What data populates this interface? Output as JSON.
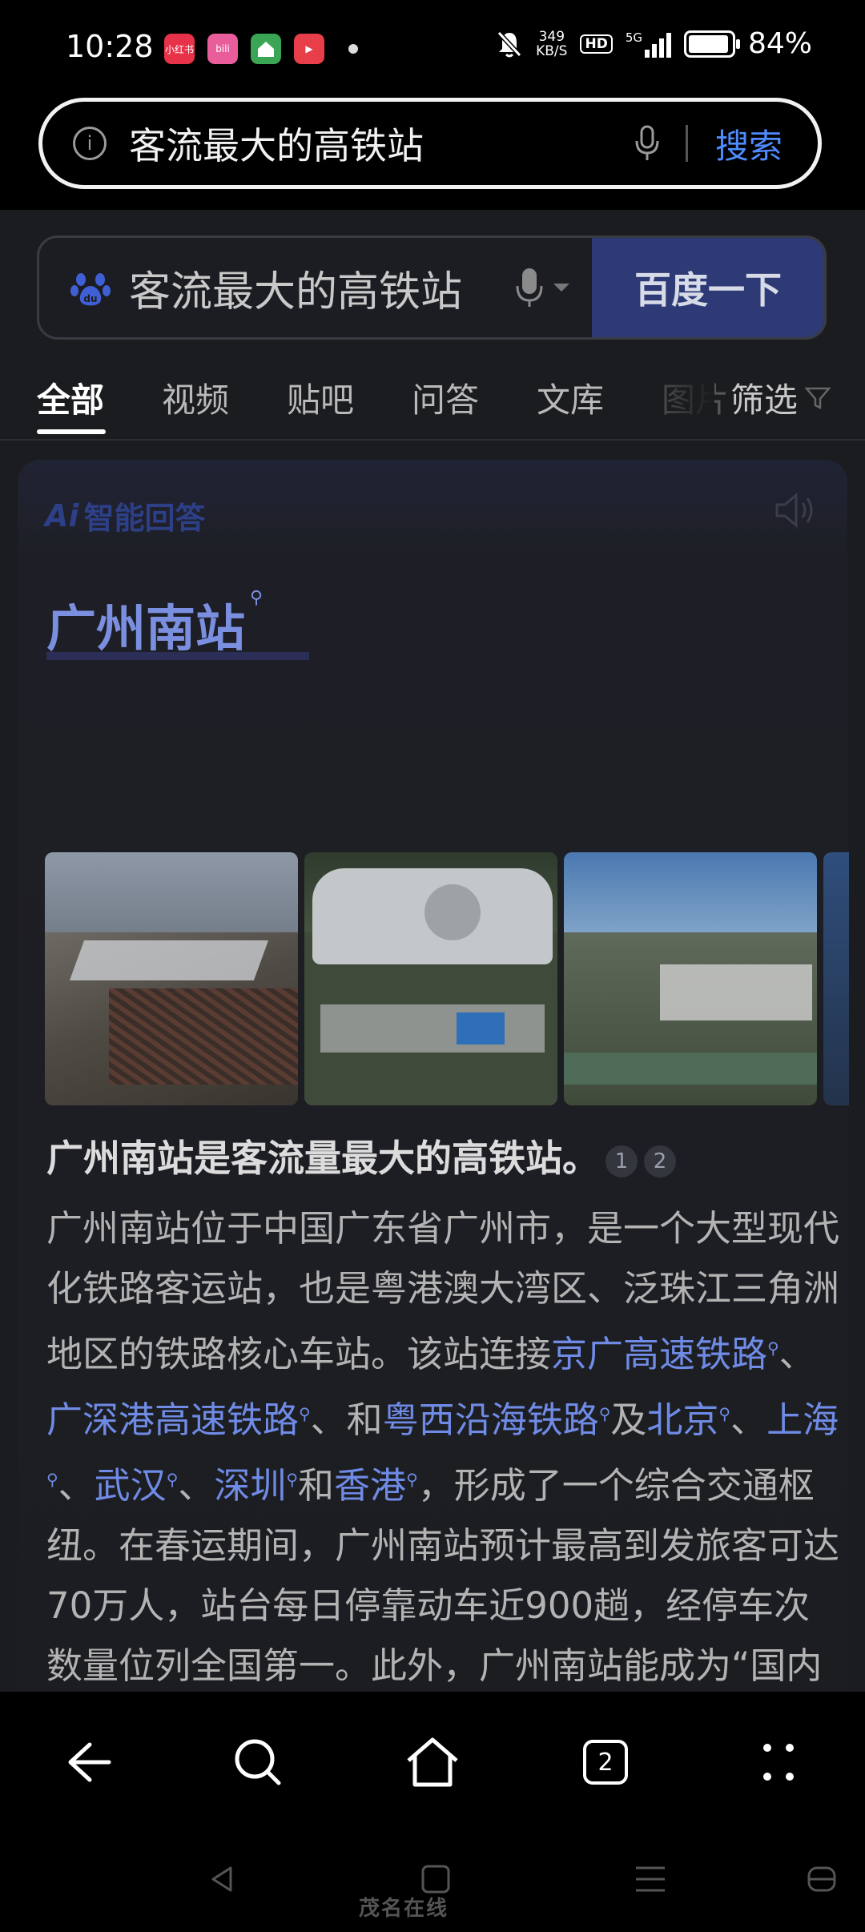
{
  "status_bar": {
    "time": "10:28",
    "apps": [
      {
        "label": "小红书",
        "color": "#e8324a"
      },
      {
        "label": "bili",
        "color": "#e85d9a"
      },
      {
        "label": "",
        "color": "#3aa655"
      },
      {
        "label": "▶",
        "color": "#e83e4a"
      }
    ],
    "speed_value": "349",
    "speed_unit": "KB/S",
    "hd_label": "HD",
    "network": "5G",
    "battery_percent": "84%",
    "battery_level": 0.84
  },
  "browser": {
    "query": "客流最大的高铁站",
    "search_label": "搜索"
  },
  "baidu": {
    "query": "客流最大的高铁站",
    "button_label": "百度一下"
  },
  "tabs": {
    "items": [
      "全部",
      "视频",
      "贴吧",
      "问答",
      "文库",
      "图片"
    ],
    "active": "全部",
    "filter_label": "筛选"
  },
  "ai_answer": {
    "logo_label": "智能回答",
    "title": "广州南站",
    "summary": "广州南站是客流量最大的高铁站。",
    "citations": [
      "1",
      "2"
    ],
    "body": [
      {
        "t": "广州南站位于中国广东省广州市，是一个大型现代化铁路客运站，也是粤港澳大湾区、泛珠江三角洲地区的铁路核心车站。该站连接"
      },
      {
        "t": "京广高速铁路",
        "link": true
      },
      {
        "t": "、"
      },
      {
        "t": "广深港高速铁路",
        "link": true
      },
      {
        "t": "、和"
      },
      {
        "t": "粤西沿海铁路",
        "link": true
      },
      {
        "t": "及"
      },
      {
        "t": "北京",
        "link": true
      },
      {
        "t": "、"
      },
      {
        "t": "上海",
        "link": true
      },
      {
        "t": "、"
      },
      {
        "t": "武汉",
        "link": true
      },
      {
        "t": "、"
      },
      {
        "t": "深圳",
        "link": true
      },
      {
        "t": "和"
      },
      {
        "t": "香港",
        "link": true
      },
      {
        "t": "，形成了一个综合交通枢纽。在春运期间，广州南站预计最高到发旅客可达70万人，站台每日停靠动车近900趟，经停车次数量位列全国第一。此外，广州南站能成为“国内最繁忙火车站”的背后，实际上是经济第一大省的巨大魅力，每年数以万计的人们通过乘坐铁"
      }
    ]
  },
  "nav_bar": {
    "tab_count": "2"
  },
  "watermark": "茂名在线"
}
